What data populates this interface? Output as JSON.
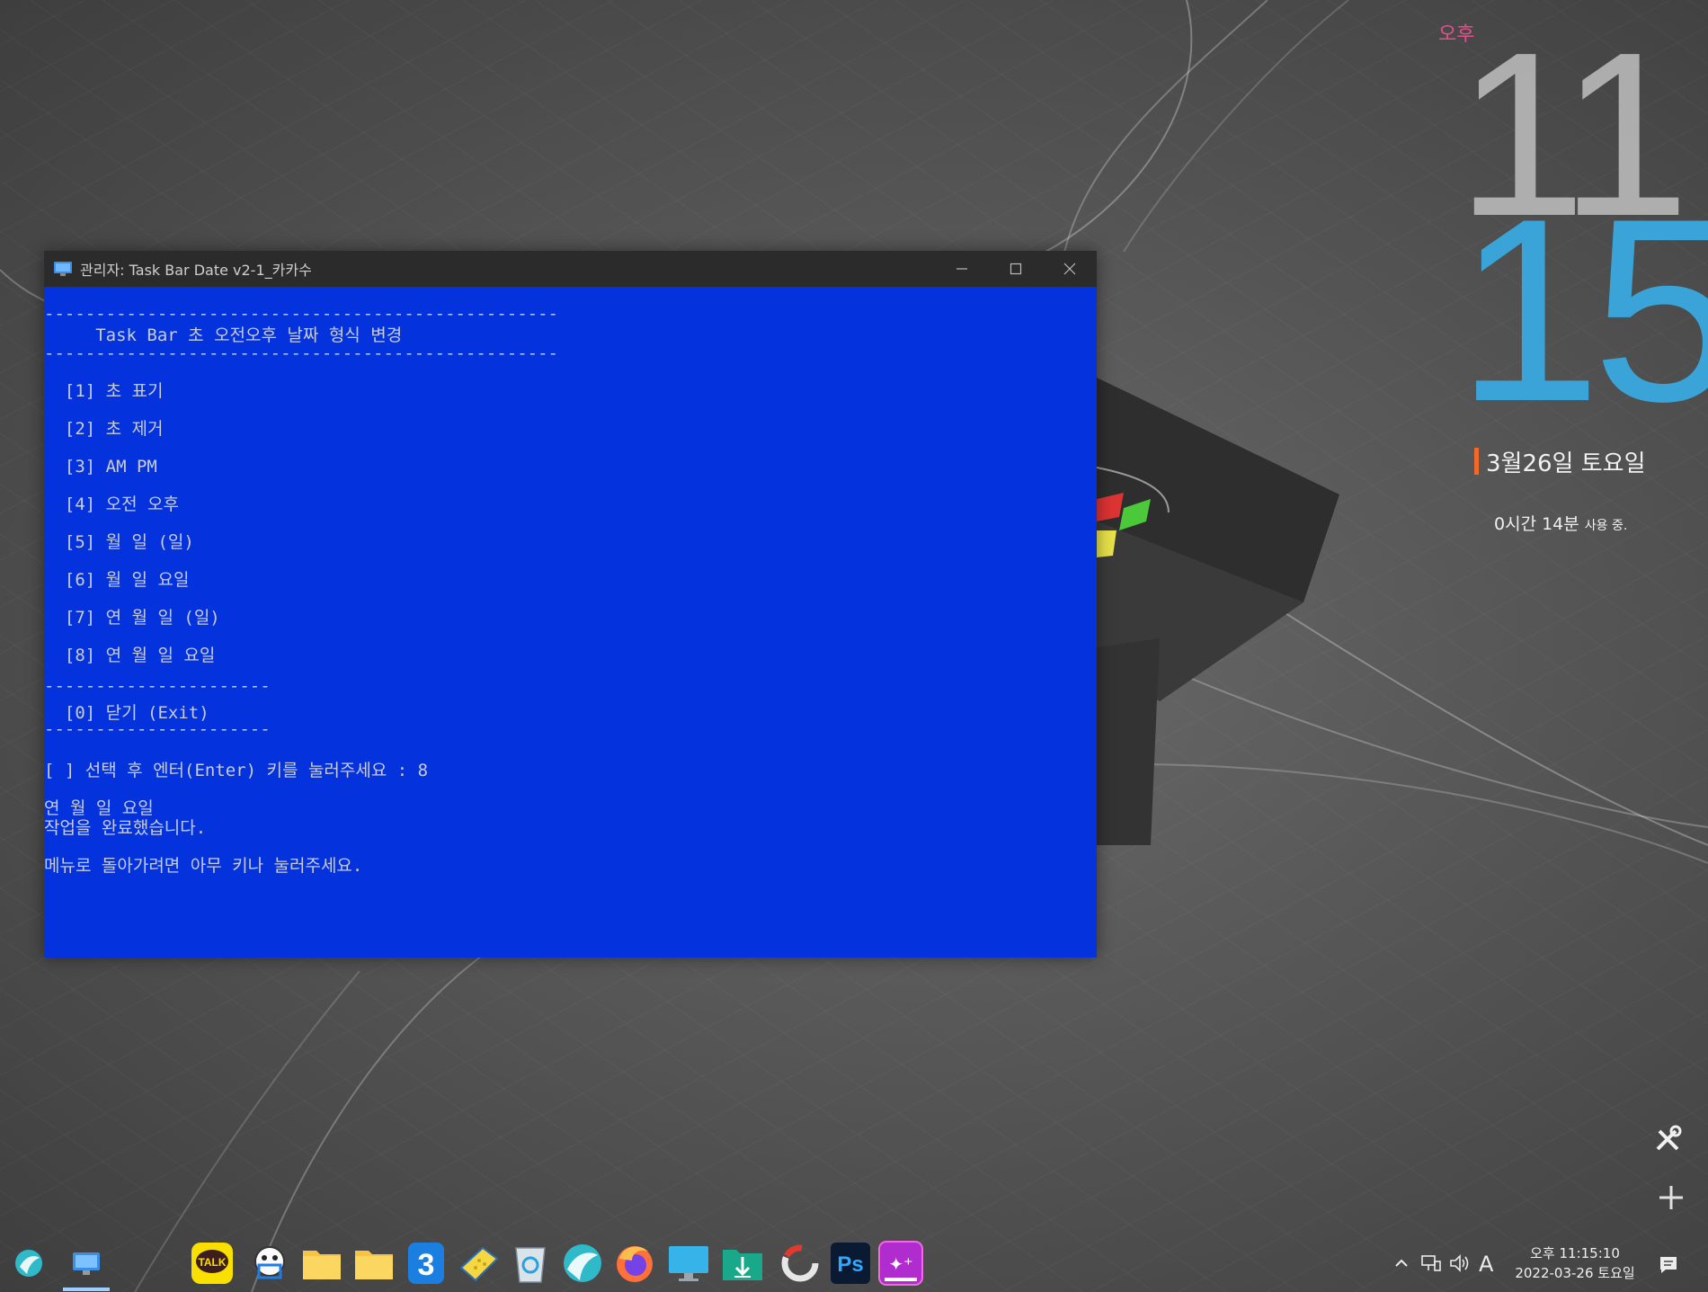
{
  "desktop": {
    "clock_widget": {
      "ampm": "오후",
      "hour": "11",
      "minute": "15",
      "date": "3월26일 토요일",
      "usage_time": "0시간 14분",
      "usage_suffix": "사용 중.",
      "accent_color": "#3aa3d8",
      "bar_color": "#f26a2a"
    }
  },
  "window": {
    "title": "관리자:  Task Bar Date v2-1_카카수",
    "background_color": "#0433de"
  },
  "console": {
    "separator_top": "--------------------------------------------------",
    "heading": "     Task Bar 초 오전오후 날짜 형식 변경",
    "separator_heading": "--------------------------------------------------",
    "menu": [
      "  [1] 초 표기",
      "  [2] 초 제거",
      "  [3] AM PM",
      "  [4] 오전 오후",
      "  [5] 월 일 (일)",
      "  [6] 월 일 요일",
      "  [7] 연 월 일 (일)",
      "  [8] 연 월 일 요일"
    ],
    "separator_exit_top": "----------------------",
    "exit_item": "  [0] 닫기 (Exit)",
    "separator_exit_bottom": "----------------------",
    "prompt": "[ ] 선택 후 엔터(Enter) 키를 눌러주세요 : 8",
    "result_line1": "연 월 일 요일",
    "result_line2": "작업을 완료했습니다.",
    "return_msg": "메뉴로 돌아가려면 아무 키나 눌러주세요."
  },
  "taskbar": {
    "tray_language": "A",
    "time": "오후 11:15:10",
    "date": "2022-03-26 토요일",
    "kakaotalk_label": "TALK",
    "photoshop_label": "Ps",
    "icons": [
      "start-orb-icon",
      "console-app-icon",
      "kakaotalk-icon",
      "capture-icon",
      "folder-icon",
      "folder-icon",
      "number-three-icon",
      "sponge-icon",
      "recycle-bin-icon",
      "whale-browser-icon",
      "firefox-icon",
      "monitor-icon",
      "download-folder-icon",
      "circle-app-icon",
      "photoshop-icon",
      "sparkle-app-icon"
    ]
  }
}
